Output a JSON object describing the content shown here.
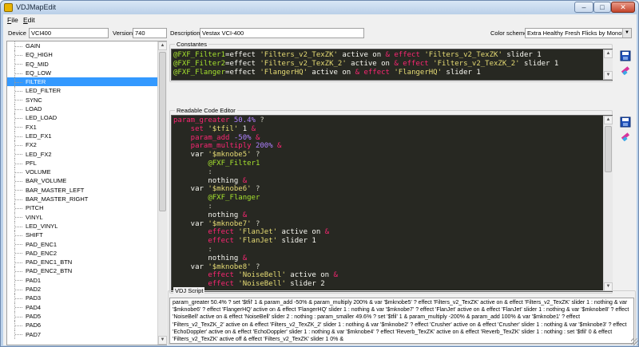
{
  "window": {
    "title": "VDJMapEdit",
    "minimize_glyph": "–",
    "maximize_glyph": "□",
    "close_glyph": "✕"
  },
  "menu": [
    {
      "label": "File",
      "underline": "F",
      "rest": "ile"
    },
    {
      "label": "Edit",
      "underline": "E",
      "rest": "dit"
    }
  ],
  "header": {
    "device_label": "Device",
    "device_value": "VCI400",
    "version_label": "Version",
    "version_value": "740",
    "description_label": "Description",
    "description_value": "Vestax VCI-400",
    "color_scheme_label": "Color scheme",
    "color_scheme_value": "Extra Healthy Fresh Flicks by Monokai"
  },
  "keys_list": {
    "selected": "FILTER",
    "items": [
      "GAIN",
      "EQ_HIGH",
      "EQ_MID",
      "EQ_LOW",
      "FILTER",
      "LED_FILTER",
      "SYNC",
      "LOAD",
      "LED_LOAD",
      "FX1",
      "LED_FX1",
      "FX2",
      "LED_FX2",
      "PFL",
      "VOLUME",
      "BAR_VOLUME",
      "BAR_MASTER_LEFT",
      "BAR_MASTER_RIGHT",
      "PITCH",
      "VINYL",
      "LED_VINYL",
      "SHIFT",
      "PAD_ENC1",
      "PAD_ENC2",
      "PAD_ENC1_BTN",
      "PAD_ENC2_BTN",
      "PAD1",
      "PAD2",
      "PAD3",
      "PAD4",
      "PAD5",
      "PAD6",
      "PAD7"
    ]
  },
  "constants": {
    "title": "Constantes",
    "lines": [
      [
        [
          "@FXF_Filter1",
          "c-grn"
        ],
        [
          "=effect ",
          "c-wht"
        ],
        [
          "'Filters_v2_TexZK'",
          "c-yel"
        ],
        [
          " active on ",
          "c-wht"
        ],
        [
          "&",
          "c-pnk"
        ],
        [
          " effect ",
          "c-pnk"
        ],
        [
          "'Filters_v2_TexZK'",
          "c-yel"
        ],
        [
          " slider 1",
          "c-wht"
        ]
      ],
      [
        [
          "@FXF_Filter2",
          "c-grn"
        ],
        [
          "=effect ",
          "c-wht"
        ],
        [
          "'Filters_v2_TexZK_2'",
          "c-yel"
        ],
        [
          " active on ",
          "c-wht"
        ],
        [
          "&",
          "c-pnk"
        ],
        [
          " effect ",
          "c-pnk"
        ],
        [
          "'Filters_v2_TexZK_2'",
          "c-yel"
        ],
        [
          " slider 1",
          "c-wht"
        ]
      ],
      [
        [
          "@FXF_Flanger",
          "c-grn"
        ],
        [
          "=effect ",
          "c-wht"
        ],
        [
          "'FlangerHQ'",
          "c-yel"
        ],
        [
          " active on ",
          "c-wht"
        ],
        [
          "&",
          "c-pnk"
        ],
        [
          " effect ",
          "c-pnk"
        ],
        [
          "'FlangerHQ'",
          "c-yel"
        ],
        [
          " slider 1",
          "c-wht"
        ]
      ]
    ],
    "save_icon": "save-icon",
    "clear_icon": "eraser-icon"
  },
  "editor": {
    "title": "Readable Code Editor",
    "lines": [
      [
        [
          "param_greater ",
          "c-pnk"
        ],
        [
          "50.4%",
          "c-prp"
        ],
        [
          " ?",
          "c-gry"
        ]
      ],
      [
        [
          "    set ",
          "c-pnk"
        ],
        [
          "'$tfil'",
          "c-yel"
        ],
        [
          " 1 ",
          "c-wht"
        ],
        [
          "&",
          "c-pnk"
        ]
      ],
      [
        [
          "    param_add ",
          "c-pnk"
        ],
        [
          "-50%",
          "c-prp"
        ],
        [
          " &",
          "c-pnk"
        ]
      ],
      [
        [
          "    param_multiply ",
          "c-pnk"
        ],
        [
          "200%",
          "c-prp"
        ],
        [
          " &",
          "c-pnk"
        ]
      ],
      [
        [
          "    var ",
          "c-wht"
        ],
        [
          "'$mknobe5'",
          "c-yel"
        ],
        [
          " ?",
          "c-gry"
        ]
      ],
      [
        [
          "        @FXF_Filter1",
          "c-grn"
        ]
      ],
      [
        [
          "        :",
          "c-gry"
        ]
      ],
      [
        [
          "        nothing ",
          "c-wht"
        ],
        [
          "&",
          "c-pnk"
        ]
      ],
      [
        [
          "    var ",
          "c-wht"
        ],
        [
          "'$mknobe6'",
          "c-yel"
        ],
        [
          " ?",
          "c-gry"
        ]
      ],
      [
        [
          "        @FXF_Flanger",
          "c-grn"
        ]
      ],
      [
        [
          "        :",
          "c-gry"
        ]
      ],
      [
        [
          "        nothing ",
          "c-wht"
        ],
        [
          "&",
          "c-pnk"
        ]
      ],
      [
        [
          "    var ",
          "c-wht"
        ],
        [
          "'$mknobe7'",
          "c-yel"
        ],
        [
          " ?",
          "c-gry"
        ]
      ],
      [
        [
          "        effect ",
          "c-pnk"
        ],
        [
          "'FlanJet'",
          "c-yel"
        ],
        [
          " active on ",
          "c-wht"
        ],
        [
          "&",
          "c-pnk"
        ]
      ],
      [
        [
          "        effect ",
          "c-pnk"
        ],
        [
          "'FlanJet'",
          "c-yel"
        ],
        [
          " slider 1",
          "c-wht"
        ]
      ],
      [
        [
          "        :",
          "c-gry"
        ]
      ],
      [
        [
          "        nothing ",
          "c-wht"
        ],
        [
          "&",
          "c-pnk"
        ]
      ],
      [
        [
          "    var ",
          "c-wht"
        ],
        [
          "'$mknobe8'",
          "c-yel"
        ],
        [
          " ?",
          "c-gry"
        ]
      ],
      [
        [
          "        effect ",
          "c-pnk"
        ],
        [
          "'NoiseBell'",
          "c-yel"
        ],
        [
          " active on ",
          "c-wht"
        ],
        [
          "&",
          "c-pnk"
        ]
      ],
      [
        [
          "        effect ",
          "c-pnk"
        ],
        [
          "'NoiseBell'",
          "c-yel"
        ],
        [
          " slider 2",
          "c-wht"
        ]
      ]
    ],
    "save_icon": "save-icon",
    "clear_icon": "eraser-icon"
  },
  "script": {
    "title": "VDJ Script",
    "text": "param_greater 50.4% ? set '$tfil' 1 & param_add -50% & param_multiply 200% & var '$mknobe5' ? effect 'Filters_v2_TexZK' active on & effect 'Filters_v2_TexZK' slider 1 : nothing & var '$mknobe6' ? effect 'FlangerHQ' active on & effect 'FlangerHQ' slider 1 : nothing & var '$mknobe7' ? effect 'FlanJet' active on & effect 'FlanJet' slider 1 : nothing & var '$mknobe8' ? effect 'NoiseBell' active on & effect 'NoiseBell' slider 2 : nothing : param_smaller 49.6% ? set '$tfil' 1 & param_multiply -200% & param_add 100% & var '$mknobe1' ? effect 'Filters_v2_TexZK_2' active on & effect 'Filters_v2_TexZK_2' slider 1 : nothing & var '$mknobe2' ? effect 'Crusher' active on & effect 'Crusher' slider 1 : nothing & var '$mknobe3' ? effect 'EchoDoppler' active on & effect 'EchoDoppler' slider 1 : nothing & var '$mknobe4' ? effect 'Reverb_TexZK' active on & effect 'Reverb_TexZK' slider 1 : nothing : set '$tfil' 0 & effect 'Filters_v2_TexZK' active off & effect 'Filters_v2_TexZK' slider 1 0% &"
  }
}
